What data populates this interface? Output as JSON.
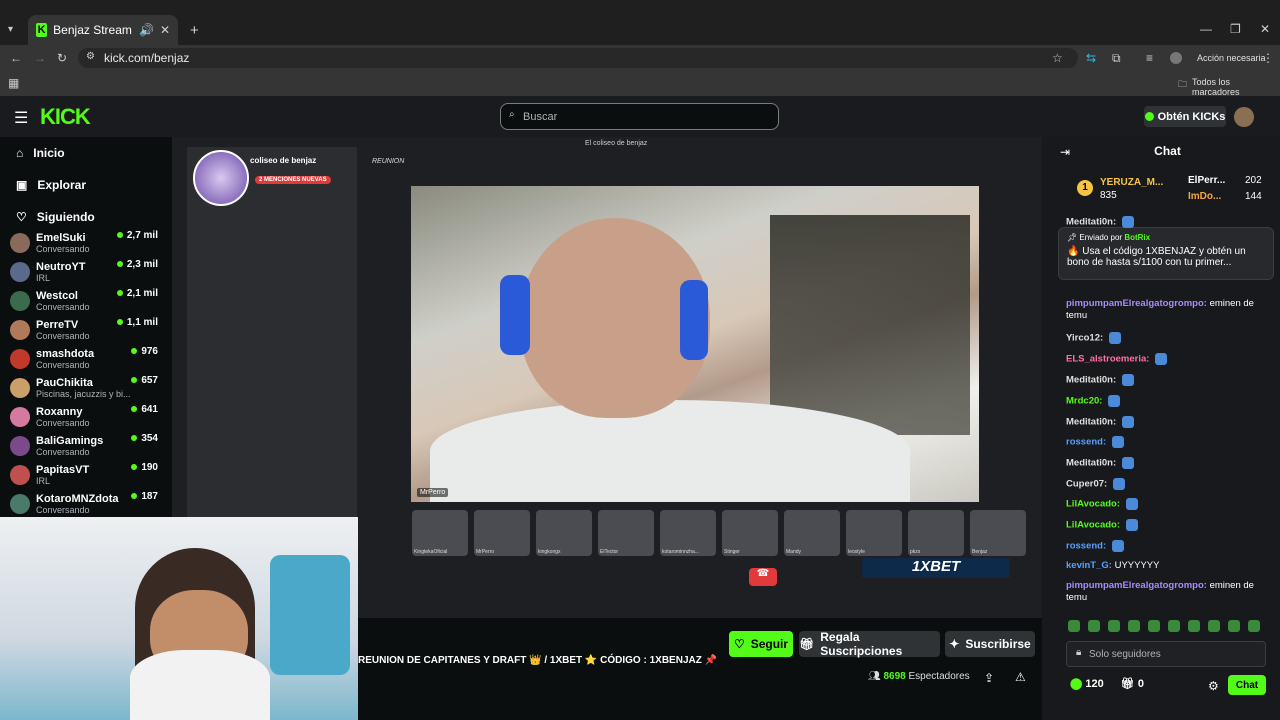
{
  "browser": {
    "tab_title": "Benjaz Stream - Watch Live",
    "url": "kick.com/benjaz",
    "action_needed": "Acción necesaria",
    "bookmarks": "Todos los marcadores"
  },
  "header": {
    "logo": "KICK",
    "search_placeholder": "Buscar",
    "get_kicks": "Obtén KICKs"
  },
  "nav": [
    {
      "label": "Inicio",
      "icon": "home-icon"
    },
    {
      "label": "Explorar",
      "icon": "compass-icon"
    },
    {
      "label": "Siguiendo",
      "icon": "heart-icon"
    }
  ],
  "channels": [
    {
      "name": "EmelSuki",
      "status": "Conversando",
      "viewers": "2,7 mil",
      "color": "#8a6a5a"
    },
    {
      "name": "NeutroYT",
      "status": "IRL",
      "viewers": "2,3 mil",
      "color": "#5a6a8a"
    },
    {
      "name": "Westcol",
      "status": "Conversando",
      "viewers": "2,1 mil",
      "color": "#3b6b4a"
    },
    {
      "name": "PerreTV",
      "status": "Conversando",
      "viewers": "1,1 mil",
      "color": "#b07a5a"
    },
    {
      "name": "smashdota",
      "status": "Conversando",
      "viewers": "976",
      "color": "#c0392b"
    },
    {
      "name": "PauChikita",
      "status": "Piscinas, jacuzzis y bi...",
      "viewers": "657",
      "color": "#caa06a"
    },
    {
      "name": "Roxanny",
      "status": "Conversando",
      "viewers": "641",
      "color": "#d47aa0"
    },
    {
      "name": "BaliGamings",
      "status": "Conversando",
      "viewers": "354",
      "color": "#7a4a8a"
    },
    {
      "name": "PapitasVT",
      "status": "IRL",
      "viewers": "190",
      "color": "#c05050"
    },
    {
      "name": "KotaroMNZdota",
      "status": "Conversando",
      "viewers": "187",
      "color": "#4a7a6a"
    }
  ],
  "video": {
    "discord_window_title": "El coliseo de benjaz",
    "server_name": "coliseo de benjaz",
    "channel": "REUNION",
    "mentions_badge": "2 MENCIONES NUEVAS",
    "cam_label": "MrPerro",
    "sponsor": "1XBET",
    "thumbs": [
      "KingtekaOficial",
      "MrPerro",
      "kingkongx",
      "ElTector",
      "kotarominnzha...",
      "Stinger",
      "Mandy",
      "leostyle",
      "pkzs",
      "Benjaz"
    ]
  },
  "stream": {
    "title": "REUNION DE CAPITANES Y DRAFT 👑  / 1XBET ⭐ CÓDIGO : 1XBENJAZ 📌",
    "viewers_count": "8698",
    "viewers_label": "Espectadores",
    "follow": "Seguir",
    "gift": "Regala Suscripciones",
    "subscribe": "Suscribirse"
  },
  "chat": {
    "title": "Chat",
    "leaderboard": [
      {
        "rank": "1",
        "name": "YERUZA_M...",
        "value": "835"
      },
      {
        "name": "ElPerr...",
        "value": "202"
      },
      {
        "name": "ImDo...",
        "value": "144"
      }
    ],
    "pinned_by": "Enviado por",
    "pinned_user": "BotRix",
    "pinned_text": "🔥 Usa el código 1XBENJAZ y obtén un bono de hasta s/1100 con tu primer...",
    "messages": [
      {
        "user": "Meditati0n:",
        "text": "",
        "color": "#e0e0e0"
      },
      {
        "user": "pimpumpamElrealgatogrompo:",
        "text": "eminen de temu",
        "color": "#a88bff"
      },
      {
        "user": "Yirco12:",
        "text": "",
        "color": "#e0e0e0"
      },
      {
        "user": "ELS_alstroemeria:",
        "text": "",
        "color": "#ff6fa8"
      },
      {
        "user": "Meditati0n:",
        "text": "",
        "color": "#e0e0e0"
      },
      {
        "user": "Mrdc20:",
        "text": "",
        "color": "#53fc18"
      },
      {
        "user": "Meditati0n:",
        "text": "",
        "color": "#e0e0e0"
      },
      {
        "user": "rossend:",
        "text": "",
        "color": "#5aa0ff"
      },
      {
        "user": "Meditati0n:",
        "text": "",
        "color": "#e0e0e0"
      },
      {
        "user": "Cuper07:",
        "text": "",
        "color": "#e0e0e0"
      },
      {
        "user": "LilAvocado:",
        "text": "",
        "color": "#53fc18"
      },
      {
        "user": "LilAvocado:",
        "text": "",
        "color": "#53fc18"
      },
      {
        "user": "rossend:",
        "text": "",
        "color": "#5aa0ff"
      },
      {
        "user": "kevinT_G:",
        "text": "UYYYYYY",
        "color": "#5aa0ff"
      },
      {
        "user": "pimpumpamElrealgatogrompo:",
        "text": "eminen de temu",
        "color": "#a88bff"
      }
    ],
    "input_placeholder": "Solo seguidores",
    "kicks_count": "120",
    "gifts_count": "0",
    "send_label": "Chat"
  }
}
